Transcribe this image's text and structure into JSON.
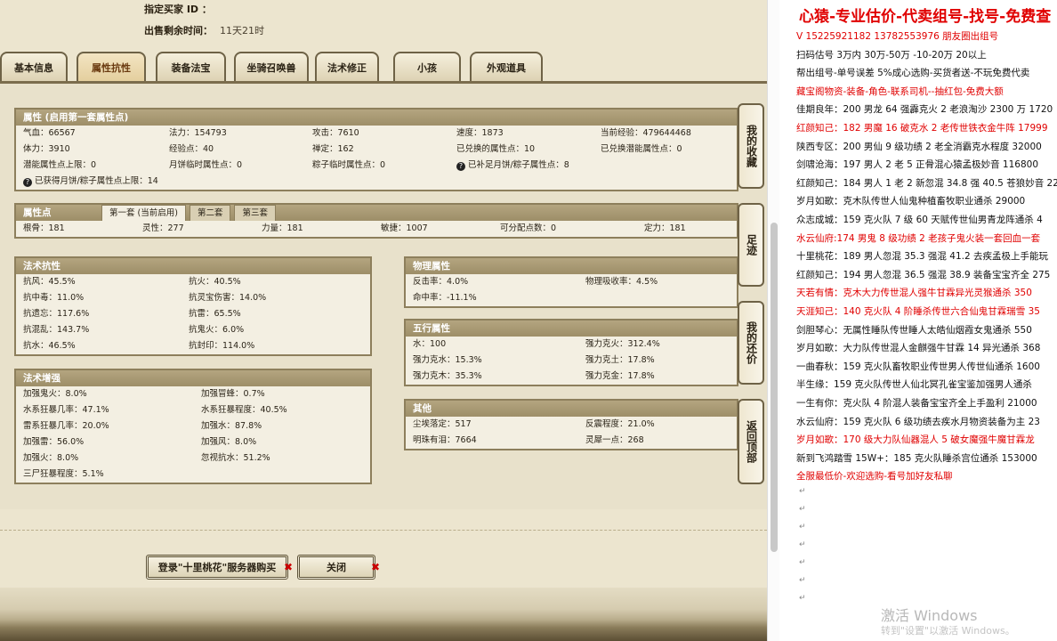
{
  "header": {
    "buyer_label": "指定买家 ID ：",
    "remaining_label": "出售剩余时间：",
    "remaining_value": "11天21时"
  },
  "tabs": [
    "基本信息",
    "属性抗性",
    "装备法宝",
    "坐骑召唤兽",
    "法术修正",
    "小孩",
    "外观道具"
  ],
  "active_tab": "属性抗性",
  "attributes": {
    "title": "属性 (启用第一套属性点)",
    "cells": [
      "气血：66567",
      "法力：154793",
      "攻击：7610",
      "速度：1873",
      "当前经验：479644468",
      "体力：3910",
      "经验点：40",
      "禅定：162",
      "已兑换的属性点：10",
      "已兑换潜能属性点：0",
      "潜能属性点上限：0",
      "月饼临时属性点：0",
      "粽子临时属性点：0",
      "已补足月饼/粽子属性点：8",
      "",
      "已获得月饼/粽子属性点上限：14"
    ]
  },
  "points": {
    "title": "属性点",
    "subtabs": [
      "第一套 (当前启用)",
      "第二套",
      "第三套"
    ],
    "cells": [
      "根骨：181",
      "灵性：277",
      "力量：181",
      "敏捷：1007",
      "可分配点数：0",
      "定力：181"
    ]
  },
  "spell_resist": {
    "title": "法术抗性",
    "cells": [
      "抗风：45.5%",
      "抗火：40.5%",
      "抗中毒：11.0%",
      "抗灵宝伤害：14.0%",
      "抗遗忘：117.6%",
      "抗雷：65.5%",
      "抗混乱：143.7%",
      "抗鬼火：6.0%",
      "抗水：46.5%",
      "抗封印：114.0%"
    ]
  },
  "spell_boost": {
    "title": "法术增强",
    "cells": [
      "加强鬼火：8.0%",
      "加强冒蜂：0.7%",
      "水系狂暴几率：47.1%",
      "水系狂暴程度：40.5%",
      "雷系狂暴几率：20.0%",
      "加强水：87.8%",
      "加强雷：56.0%",
      "加强风：8.0%",
      "加强火：8.0%",
      "忽视抗水：51.2%",
      "三尸狂暴程度：5.1%",
      ""
    ]
  },
  "physical": {
    "title": "物理属性",
    "cells": [
      "反击率：4.0%",
      "物理吸收率：4.5%",
      "命中率：-11.1%",
      ""
    ]
  },
  "five_elements": {
    "title": "五行属性",
    "cells": [
      "水：100",
      "强力克火：312.4%",
      "强力克水：15.3%",
      "强力克土：17.8%",
      "强力克木：35.3%",
      "强力克金：17.8%"
    ]
  },
  "other": {
    "title": "其他",
    "cells": [
      "尘埃落定：517",
      "反震程度：21.0%",
      "明珠有泪：7664",
      "灵犀一点：268"
    ]
  },
  "side_buttons": [
    "我的收藏",
    "足迹",
    "我的还价",
    "返回顶部"
  ],
  "actions": {
    "login_buy": "登录\"十里桃花\"服务器购买",
    "close": "关闭"
  },
  "doc": {
    "title": "心猿-专业估价-代卖组号-找号-免费查",
    "lines": [
      {
        "text": "V 15225921182  13782553976 朋友圈出组号",
        "red": true
      },
      {
        "text": "扫码估号 3万内 30万-50万 -10-20万 20以上",
        "red": false
      },
      {
        "text": "帮出组号-单号误差 5%成心选购-买货者送-不玩免费代卖",
        "red": false
      },
      {
        "text": "藏宝阁物资-装备-角色-联系司机--抽红包-免费大额",
        "red": true
      },
      {
        "text": "佳期良年：200 男龙 64 强霹克火 2 老浪淘沙 2300 万 1720",
        "red": false
      },
      {
        "text": "红颜知己：182 男魔 16 破克水 2 老传世铁衣金牛阵 17999",
        "red": true
      },
      {
        "text": "陕西专区：200 男仙 9 级功绩 2 老全消霸克水程度 32000",
        "red": false
      },
      {
        "text": "剑啸沧海：197 男人 2 老 5 正骨混心猿孟极妙音 116800",
        "red": false
      },
      {
        "text": "红颜知己：184 男人 1 老 2 新忽混 34.8 强 40.5 苍狼妙音 22",
        "red": false
      },
      {
        "text": "岁月如歌：克木队传世人仙鬼种植畜牧职业通杀 29000",
        "red": false
      },
      {
        "text": "众志成城：159 克火队 7 级 60 天赋传世仙男青龙阵通杀 4",
        "red": false
      },
      {
        "text": "水云仙府:174 男鬼 8 级功绩 2 老孩子鬼火装一套回血一套",
        "red": true
      },
      {
        "text": "十里桃花：189 男人忽混 35.3 强混 41.2 去疾孟极上手能玩",
        "red": false
      },
      {
        "text": "红颜知己：194 男人忽混 36.5 强混 38.9 装备宝宝齐全 275",
        "red": false
      },
      {
        "text": "天若有情：克木大力传世混人强牛甘霖异光灵猴通杀 350",
        "red": true
      },
      {
        "text": "天涯知己：140 克火队 4 阶睡杀传世六合仙鬼甘霖瑞雪 35",
        "red": true
      },
      {
        "text": "剑胆琴心：无属性睡队传世睡人太皓仙烟霞女鬼通杀 550",
        "red": false
      },
      {
        "text": "岁月如歌：大力队传世混人金麒强牛甘霖 14 异光通杀 368",
        "red": false
      },
      {
        "text": "一曲春秋：159 克火队畜牧职业传世男人传世仙通杀 1600",
        "red": false
      },
      {
        "text": "半生缘：159 克火队传世人仙北冥孔雀宝鉴加强男人通杀",
        "red": false
      },
      {
        "text": "一生有你：克火队 4 阶混人装备宝宝齐全上手盈利 21000",
        "red": false
      },
      {
        "text": "水云仙府：159 克火队 6 级功绩去疾水月物资装备为主 23",
        "red": false
      },
      {
        "text": "岁月如歌：170 级大力队仙器混人 5 破女魔强牛魔甘霖龙",
        "red": true
      },
      {
        "text": "新到飞鸿踏雪 15W+：185 克火队睡杀宫位通杀 153000",
        "red": false
      },
      {
        "text": "全服最低价-欢迎选购-看号加好友私聊",
        "red": true
      }
    ],
    "watermark": "激活 Windows",
    "watermark_sub": "转到\"设置\"以激活 Windows。"
  }
}
